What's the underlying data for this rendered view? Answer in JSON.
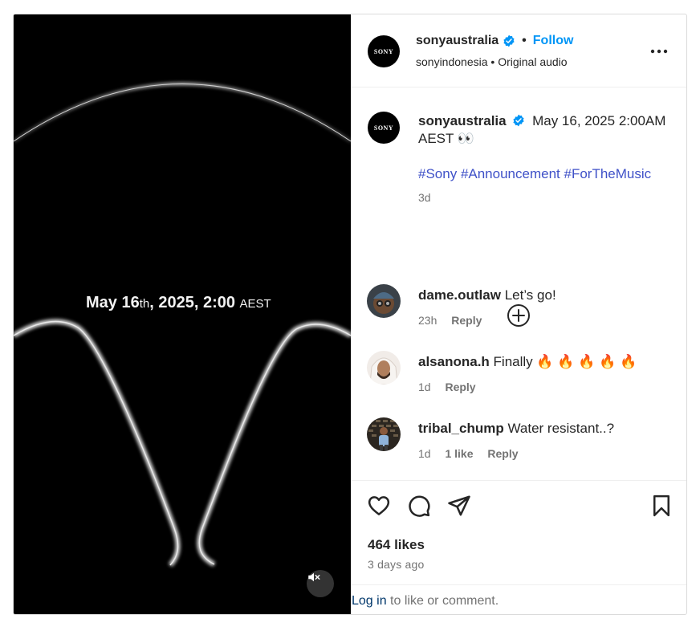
{
  "media": {
    "date_main": "May 16",
    "date_th": "th",
    "date_rest": ", 2025, 2:00 ",
    "date_tz": "AEST"
  },
  "header": {
    "avatar_text": "SONY",
    "username": "sonyaustralia",
    "separator": "•",
    "follow_label": "Follow",
    "subtitle": "sonyindonesia • Original audio"
  },
  "caption": {
    "avatar_text": "SONY",
    "username": "sonyaustralia",
    "text": "May 16, 2025 2:00AM AEST 👀",
    "hashtags": [
      "#Sony",
      "#Announcement",
      "#ForTheMusic"
    ],
    "time": "3d"
  },
  "comments": [
    {
      "username": "dame.outlaw",
      "text": "Let’s go!",
      "time": "23h",
      "likes": "",
      "reply": "Reply"
    },
    {
      "username": "alsanona.h",
      "text": "Finally 🔥 🔥 🔥 🔥 🔥",
      "time": "1d",
      "likes": "",
      "reply": "Reply"
    },
    {
      "username": "tribal_chump",
      "text": "Water resistant..?",
      "time": "1d",
      "likes": "1 like",
      "reply": "Reply"
    }
  ],
  "footer": {
    "likes": "464 likes",
    "ago": "3 days ago",
    "login_link": "Log in",
    "login_rest": " to like or comment."
  },
  "colors": {
    "accent": "#0095f6",
    "hashtag": "#3f51c8",
    "muted": "#737373",
    "link_dark": "#00376b"
  },
  "icons": [
    "verified-badge-icon",
    "more-options-icon",
    "add-comment-icon",
    "heart-icon",
    "comment-icon",
    "share-icon",
    "bookmark-icon",
    "mute-icon"
  ]
}
